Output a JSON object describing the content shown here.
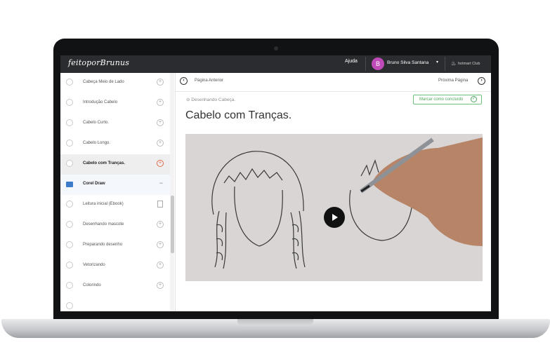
{
  "app": {
    "logo_text": "feitoporBrunus",
    "help_label": "Ajuda",
    "user_initial": "B",
    "user_name": "Bruno Silva Santana",
    "club_label": "hotmart Club"
  },
  "sidebar": {
    "items": [
      {
        "label": "Cabeça Meio de Lado",
        "state": "normal"
      },
      {
        "label": "Introdução Cabelo",
        "state": "normal"
      },
      {
        "label": "Cabelo Curto.",
        "state": "normal"
      },
      {
        "label": "Cabelo Longo.",
        "state": "normal"
      },
      {
        "label": "Cabelo com Tranças.",
        "state": "active"
      },
      {
        "label": "Corel Draw",
        "state": "section"
      },
      {
        "label": "Leitura inicial (Ebook)",
        "state": "normal"
      },
      {
        "label": "Desenhando mascote",
        "state": "normal"
      },
      {
        "label": "Preparando desenho",
        "state": "normal"
      },
      {
        "label": "Vetorizando",
        "state": "normal"
      },
      {
        "label": "Colorindo",
        "state": "normal"
      }
    ]
  },
  "main": {
    "prev_label": "Página Anterior",
    "next_label": "Próxima Página",
    "breadcrumb": "Desenhando Cabeça.",
    "complete_label": "Marcar como concluído",
    "title": "Cabelo com Tranças."
  },
  "colors": {
    "accent_green": "#4ca85c",
    "active_red": "#e06a4e",
    "avatar_purple": "#c04bb8",
    "topbar": "#2b2c2f"
  },
  "icons": [
    "play-icon",
    "check-icon",
    "plus-icon",
    "folder-icon",
    "document-icon",
    "chevron-left-icon",
    "chevron-right-icon"
  ]
}
